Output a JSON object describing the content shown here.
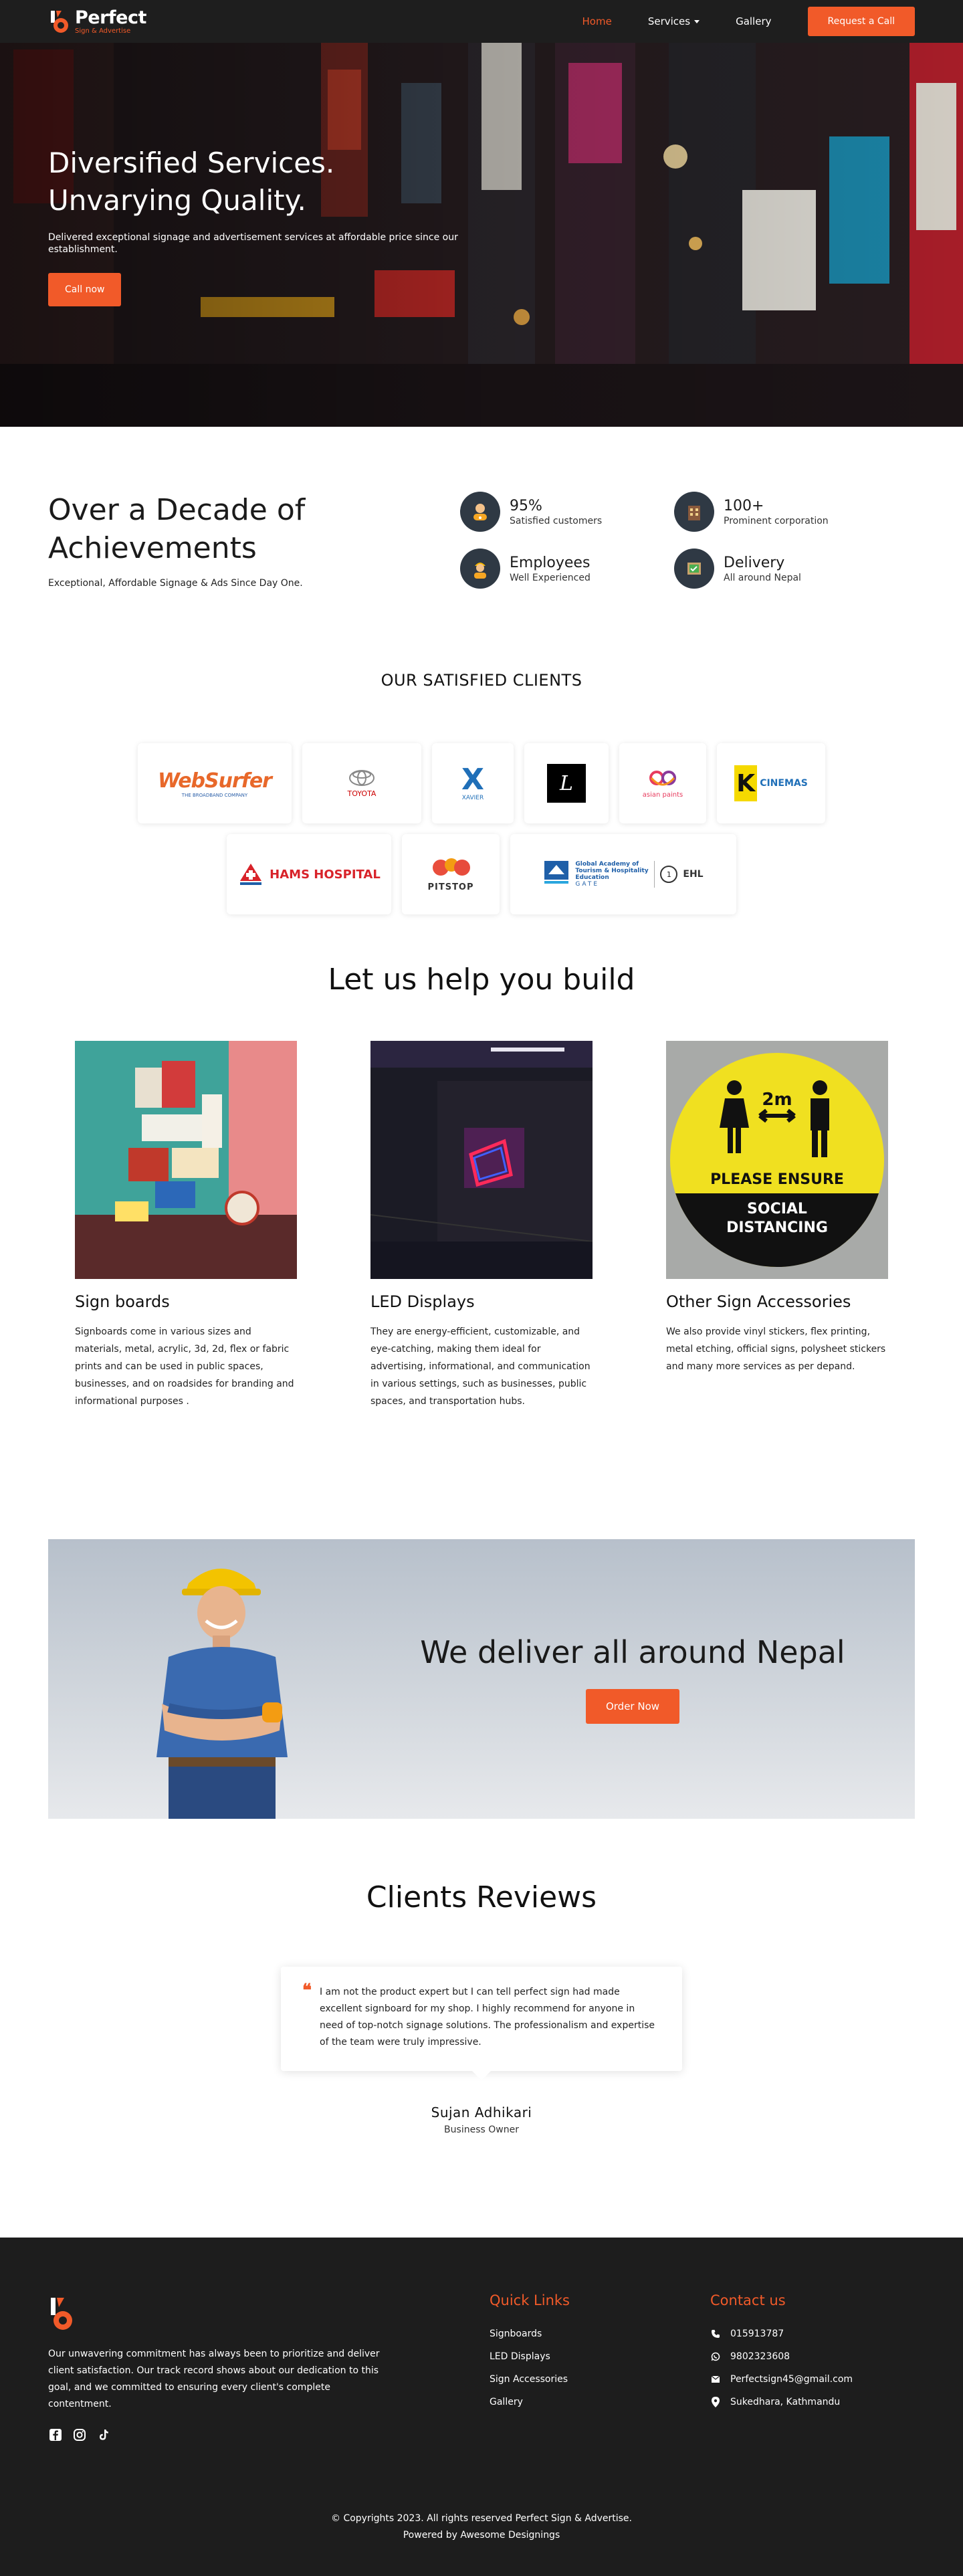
{
  "brand": {
    "name": "Perfect",
    "tagline": "Sign & Advertise",
    "accent_color": "#f15a29"
  },
  "nav": {
    "links": [
      "Home",
      "Services",
      "Gallery"
    ],
    "active": "Home",
    "cta": "Request a Call"
  },
  "hero": {
    "title_line1": "Diversified Services.",
    "title_line2": "Unvarying Quality.",
    "subtitle": "Delivered exceptional signage and advertisement services at affordable price since our establishment.",
    "button": "Call now"
  },
  "achievements": {
    "title": "Over a Decade of Achievements",
    "subtitle": "Exceptional, Affordable Signage & Ads Since Day One.",
    "stats": [
      {
        "value": "95%",
        "label": "Satisfied customers",
        "icon": "customer-icon"
      },
      {
        "value": "100+",
        "label": "Prominent corporation",
        "icon": "building-icon"
      },
      {
        "value": "Employees",
        "label": "Well Experienced",
        "icon": "worker-icon"
      },
      {
        "value": "Delivery",
        "label": "All around Nepal",
        "icon": "delivery-icon"
      }
    ]
  },
  "clients": {
    "heading": "OUR SATISFIED CLIENTS",
    "logos": [
      {
        "name": "WebSurfer",
        "caption": "THE BROADBAND COMPANY"
      },
      {
        "name": "TOYOTA"
      },
      {
        "name": "XAVIER"
      },
      {
        "name": "L"
      },
      {
        "name": "asian paints"
      },
      {
        "name": "CINEMAS"
      },
      {
        "name": "HAMS HOSPITAL"
      },
      {
        "name": "PITSTOP"
      },
      {
        "name": "GATE",
        "caption": "Global Academy of Tourism & Hospitality Education"
      }
    ]
  },
  "services": {
    "title": "Let us help you build",
    "items": [
      {
        "name": "Sign boards",
        "desc": "Signboards come in various sizes and materials, metal, acrylic, 3d, 2d, flex or fabric prints and can be used in public spaces, businesses, and on roadsides for branding and informational purposes ."
      },
      {
        "name": "LED Displays",
        "desc": "They are energy-efficient, customizable, and eye-catching, making them ideal for advertising, informational, and communication in various settings, such as businesses, public spaces, and transportation hubs."
      },
      {
        "name": "Other Sign Accessories",
        "desc": "We also provide vinyl stickers, flex printing, metal etching, official signs, polysheet stickers and many more services as per depand."
      }
    ],
    "sign_text": {
      "distance": "2m",
      "line1": "PLEASE ENSURE",
      "line2": "SOCIAL",
      "line3": "DISTANCING"
    }
  },
  "delivery": {
    "title": "We deliver all around Nepal",
    "button": "Order Now"
  },
  "reviews": {
    "title": "Clients Reviews",
    "text": "I am not the product expert but I can tell perfect sign had made excellent signboard for my shop. I highly recommend for anyone in need of top-notch signage solutions. The professionalism and expertise of the team were truly impressive.",
    "name": "Sujan Adhikari",
    "role": "Business Owner"
  },
  "footer": {
    "about": "Our unwavering commitment has always been to prioritize and deliver client satisfaction. Our track record shows about our dedication to this goal, and we committed to ensuring every client's complete contentment.",
    "quick_links_title": "Quick Links",
    "quick_links": [
      "Signboards",
      "LED Displays",
      "Sign Accessories",
      "Gallery"
    ],
    "contact_title": "Contact us",
    "contacts": [
      {
        "icon": "phone-icon",
        "text": "015913787"
      },
      {
        "icon": "whatsapp-icon",
        "text": "9802323608"
      },
      {
        "icon": "email-icon",
        "text": "Perfectsign45@gmail.com"
      },
      {
        "icon": "location-icon",
        "text": "Sukedhara, Kathmandu"
      }
    ],
    "copyright": "© Copyrights 2023. All rights reserved Perfect Sign & Advertise.",
    "powered": "Powered by Awesome Designings"
  }
}
